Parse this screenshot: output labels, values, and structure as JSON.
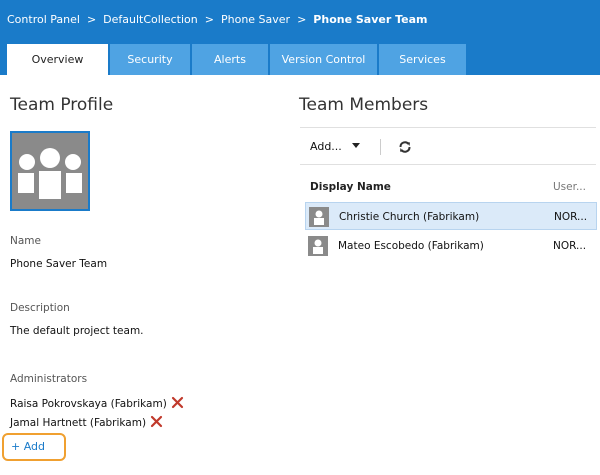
{
  "breadcrumb": {
    "items": [
      "Control Panel",
      "DefaultCollection",
      "Phone Saver"
    ],
    "separator": ">",
    "current": "Phone Saver Team"
  },
  "tabs": [
    {
      "label": "Overview",
      "active": true
    },
    {
      "label": "Security",
      "active": false
    },
    {
      "label": "Alerts",
      "active": false
    },
    {
      "label": "Version Control",
      "active": false
    },
    {
      "label": "Services",
      "active": false
    }
  ],
  "profile": {
    "title": "Team Profile",
    "avatar_icon": "team-avatar-icon",
    "name_label": "Name",
    "name_value": "Phone Saver Team",
    "description_label": "Description",
    "description_value": "The default project team.",
    "administrators_label": "Administrators",
    "administrators": [
      "Raisa Pokrovskaya (Fabrikam)",
      "Jamal Hartnett (Fabrikam)"
    ],
    "add_label": "+ Add"
  },
  "members": {
    "title": "Team Members",
    "toolbar": {
      "add_label": "Add...",
      "refresh_icon": "refresh-icon"
    },
    "columns": {
      "display_name": "Display Name",
      "user": "User..."
    },
    "rows": [
      {
        "name": "Christie Church (Fabrikam)",
        "user": "NOR...",
        "selected": true
      },
      {
        "name": "Mateo Escobedo (Fabrikam)",
        "user": "NOR...",
        "selected": false
      }
    ]
  },
  "colors": {
    "header": "#1a7bc9",
    "tab_inactive": "#4fa3e3",
    "selected_row": "#dbeaf9",
    "remove_x": "#c0392b",
    "highlight": "#f0a030"
  }
}
